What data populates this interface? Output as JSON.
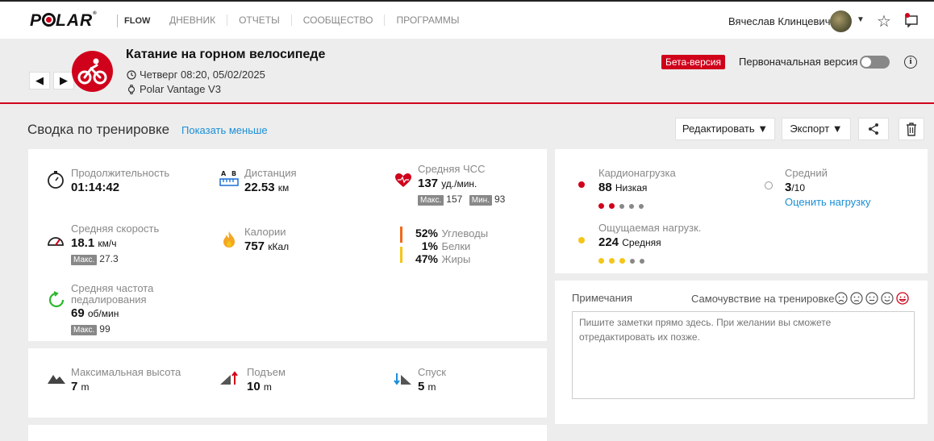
{
  "nav": {
    "brand": "POLAR",
    "product": "FLOW",
    "items": [
      "ДНЕВНИК",
      "ОТЧЕТЫ",
      "СООБЩЕСТВО",
      "ПРОГРАММЫ"
    ],
    "user_name": "Вячеслав Клинцевич"
  },
  "header": {
    "title": "Катание на горном велосипеде",
    "datetime": "Четверг 08:20, 05/02/2025",
    "device": "Polar Vantage V3",
    "beta_label": "Бета-версия",
    "original_label": "Первоначальная версия",
    "info_label": "i"
  },
  "summary": {
    "title": "Сводка по тренировке",
    "show_less": "Показать меньше",
    "edit_label": "Редактировать ▼",
    "export_label": "Экспорт ▼"
  },
  "metrics": {
    "duration": {
      "label": "Продолжительность",
      "value": "01:14:42"
    },
    "distance": {
      "label": "Дистанция",
      "value": "22.53",
      "unit": "км"
    },
    "avg_hr": {
      "label": "Средняя ЧСС",
      "value": "137",
      "unit": "уд./мин.",
      "max_label": "Макс.",
      "max": "157",
      "min_label": "Мин.",
      "min": "93"
    },
    "avg_speed": {
      "label": "Средняя скорость",
      "value": "18.1",
      "unit": "км/ч",
      "max_label": "Макс.",
      "max": "27.3"
    },
    "calories": {
      "label": "Калории",
      "value": "757",
      "unit": "кКал"
    },
    "carbs": {
      "pct": "52%",
      "label": "Углеводы"
    },
    "protein": {
      "pct": "1%",
      "label": "Белки"
    },
    "fat": {
      "pct": "47%",
      "label": "Жиры"
    },
    "cadence": {
      "label_line1": "Средняя частота",
      "label_line2": "педалирования",
      "value": "69",
      "unit": "об/мин",
      "max_label": "Макс.",
      "max": "99"
    }
  },
  "elevation": {
    "max_alt": {
      "label": "Максимальная высота",
      "value": "7",
      "unit": "m"
    },
    "ascent": {
      "label": "Подъем",
      "value": "10",
      "unit": "m"
    },
    "descent": {
      "label": "Спуск",
      "value": "5",
      "unit": "m"
    }
  },
  "load": {
    "cardio": {
      "label": "Кардионагрузка",
      "value": "88",
      "text": "Низкая",
      "filled_dots": 2,
      "total_dots": 5
    },
    "average": {
      "label": "Средний",
      "value": "3",
      "suffix": "/10",
      "link": "Оценить нагрузку"
    },
    "perceived": {
      "label": "Ощущаемая нагрузк.",
      "value": "224",
      "text": "Средняя",
      "filled_dots": 3,
      "total_dots": 5
    }
  },
  "notes": {
    "label": "Примечания",
    "feeling_label": "Самочувствие на тренировке",
    "placeholder": "Пишите заметки прямо здесь. При желании вы сможете отредактировать их позже."
  },
  "colors": {
    "accent": "#d0021b",
    "link": "#1a8fd6",
    "yellow": "#f5c518"
  }
}
